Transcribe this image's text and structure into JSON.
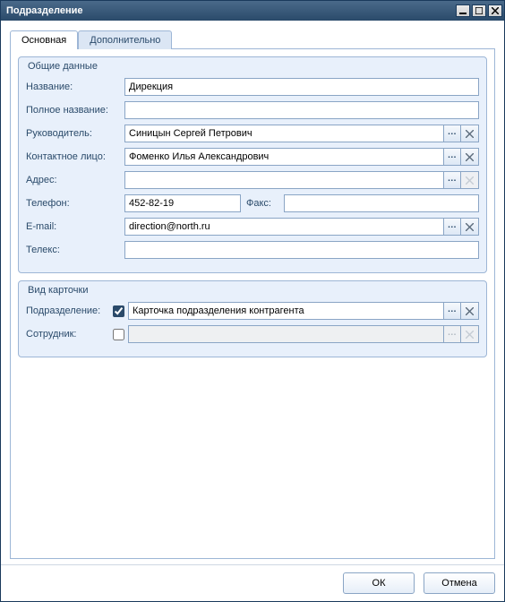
{
  "window": {
    "title": "Подразделение"
  },
  "tabs": {
    "main": "Основная",
    "extra": "Дополнительно"
  },
  "group_general": {
    "legend": "Общие данные",
    "labels": {
      "name": "Название:",
      "fullname": "Полное название:",
      "manager": "Руководитель:",
      "contact": "Контактное лицо:",
      "address": "Адрес:",
      "phone": "Телефон:",
      "fax": "Факс:",
      "email": "E-mail:",
      "telex": "Телекс:"
    },
    "values": {
      "name": "Дирекция",
      "fullname": "",
      "manager": "Синицын Сергей Петрович",
      "contact": "Фоменко Илья Александрович",
      "address": "",
      "phone": "452-82-19",
      "fax": "",
      "email": "direction@north.ru",
      "telex": ""
    }
  },
  "group_card": {
    "legend": "Вид карточки",
    "labels": {
      "department": "Подразделение:",
      "employee": "Сотрудник:"
    },
    "values": {
      "department_enabled": true,
      "department": "Карточка подразделения контрагента",
      "employee_enabled": false,
      "employee": ""
    }
  },
  "buttons": {
    "ok": "ОК",
    "cancel": "Отмена"
  },
  "icons": {
    "ellipsis": "...",
    "clear": "x"
  }
}
